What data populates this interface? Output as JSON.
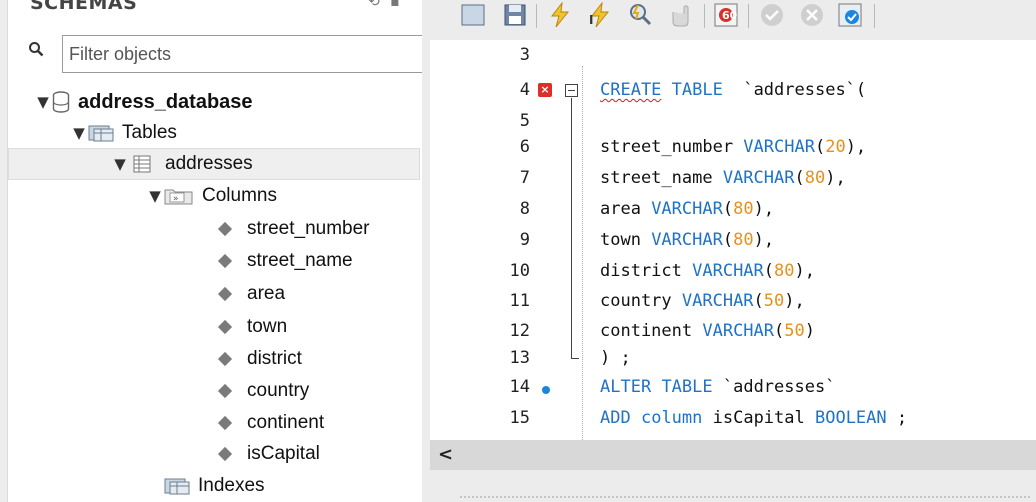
{
  "schemas": {
    "title": "SCHEMAS",
    "filter_placeholder": "Filter objects",
    "tree": [
      {
        "label": "address_database",
        "type": "database",
        "expanded": true
      },
      {
        "label": "Tables",
        "type": "folder",
        "expanded": true
      },
      {
        "label": "addresses",
        "type": "table",
        "expanded": true,
        "selected": true
      },
      {
        "label": "Columns",
        "type": "columns-folder",
        "expanded": true
      },
      {
        "label": "street_number",
        "type": "column"
      },
      {
        "label": "street_name",
        "type": "column"
      },
      {
        "label": "area",
        "type": "column"
      },
      {
        "label": "town",
        "type": "column"
      },
      {
        "label": "district",
        "type": "column"
      },
      {
        "label": "country",
        "type": "column"
      },
      {
        "label": "continent",
        "type": "column"
      },
      {
        "label": "isCapital",
        "type": "column"
      },
      {
        "label": "Indexes",
        "type": "folder"
      }
    ]
  },
  "editor": {
    "line_numbers": [
      "3",
      "4",
      "5",
      "6",
      "7",
      "8",
      "9",
      "10",
      "11",
      "12",
      "13",
      "14",
      "15"
    ],
    "lines": [
      {
        "n": "3",
        "text": ""
      },
      {
        "n": "4",
        "kw1": "CREATE",
        "kw2": "TABLE",
        "rest": "  `addresses`("
      },
      {
        "n": "5",
        "text": ""
      },
      {
        "n": "6",
        "name": "street_number ",
        "type": "VARCHAR",
        "open": "(",
        "size": "20",
        "close": "),"
      },
      {
        "n": "7",
        "name": "street_name ",
        "type": "VARCHAR",
        "open": "(",
        "size": "80",
        "close": "),"
      },
      {
        "n": "8",
        "name": "area ",
        "type": "VARCHAR",
        "open": "(",
        "size": "80",
        "close": "),"
      },
      {
        "n": "9",
        "name": "town ",
        "type": "VARCHAR",
        "open": "(",
        "size": "80",
        "close": "),"
      },
      {
        "n": "10",
        "name": "district ",
        "type": "VARCHAR",
        "open": "(",
        "size": "80",
        "close": "),"
      },
      {
        "n": "11",
        "name": "country ",
        "type": "VARCHAR",
        "open": "(",
        "size": "50",
        "close": "),"
      },
      {
        "n": "12",
        "name": "continent ",
        "type": "VARCHAR",
        "open": "(",
        "size": "50",
        "close": ")"
      },
      {
        "n": "13",
        "text": ") ;"
      },
      {
        "n": "14",
        "kw1": "ALTER",
        "kw2": "TABLE",
        "rest": " `addresses`"
      },
      {
        "n": "15",
        "kw1": "ADD",
        "kw2": "column",
        "col": " isCapital ",
        "kw3": "BOOLEAN",
        "rest": " ;"
      }
    ],
    "error_marker": "×"
  },
  "scrollbar": {
    "left_arrow": "<"
  },
  "icons": [
    "search-icon",
    "database-icon",
    "table-folder-icon",
    "table-icon",
    "columns-folder-icon",
    "column-diamond-icon",
    "index-folder-icon",
    "save-icon",
    "execute-icon",
    "execute-current-icon",
    "explain-icon",
    "stop-icon",
    "commit-icon",
    "rollback-icon",
    "toggle-autocommit-icon"
  ],
  "colors": {
    "keyword": "#1e73c8",
    "number": "#e8901f",
    "error": "#d9302c",
    "bookmark": "#1a86e0"
  }
}
